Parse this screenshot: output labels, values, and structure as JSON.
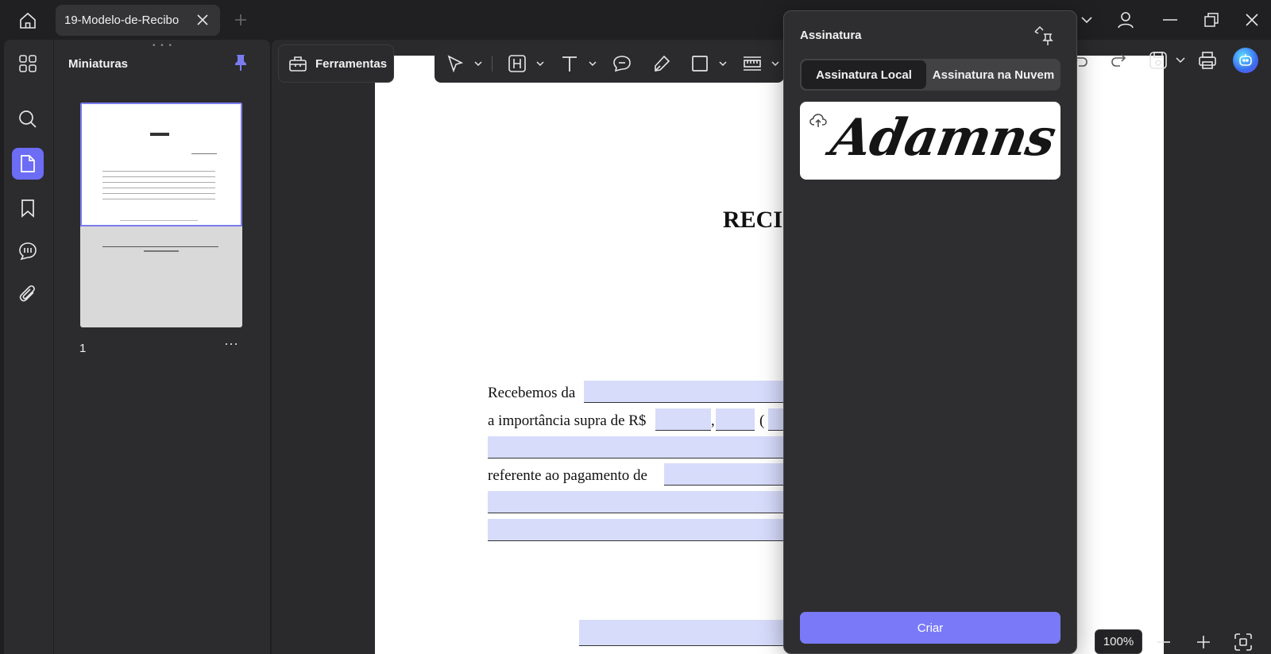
{
  "tab": {
    "title": "19-Modelo-de-Recibo"
  },
  "thumbnails": {
    "title": "Miniaturas",
    "page_label": "1",
    "more": "···"
  },
  "toolbar": {
    "tools_label": "Ferramentas"
  },
  "document": {
    "title": "RECI",
    "line1": "Recebemos da",
    "line2": "a importância supra de R$",
    "line2_comma": ",",
    "line2_paren": "(",
    "line3": "referente ao pagamento de"
  },
  "signature_panel": {
    "title": "Assinatura",
    "tab_local": "Assinatura Local",
    "tab_cloud": "Assinatura na Nuvem",
    "signature_text": "Adamns",
    "create_button": "Criar"
  },
  "zoom": {
    "level": "100%"
  },
  "colors": {
    "accent": "#7a7af8",
    "highlight": "#d7dcfb"
  }
}
